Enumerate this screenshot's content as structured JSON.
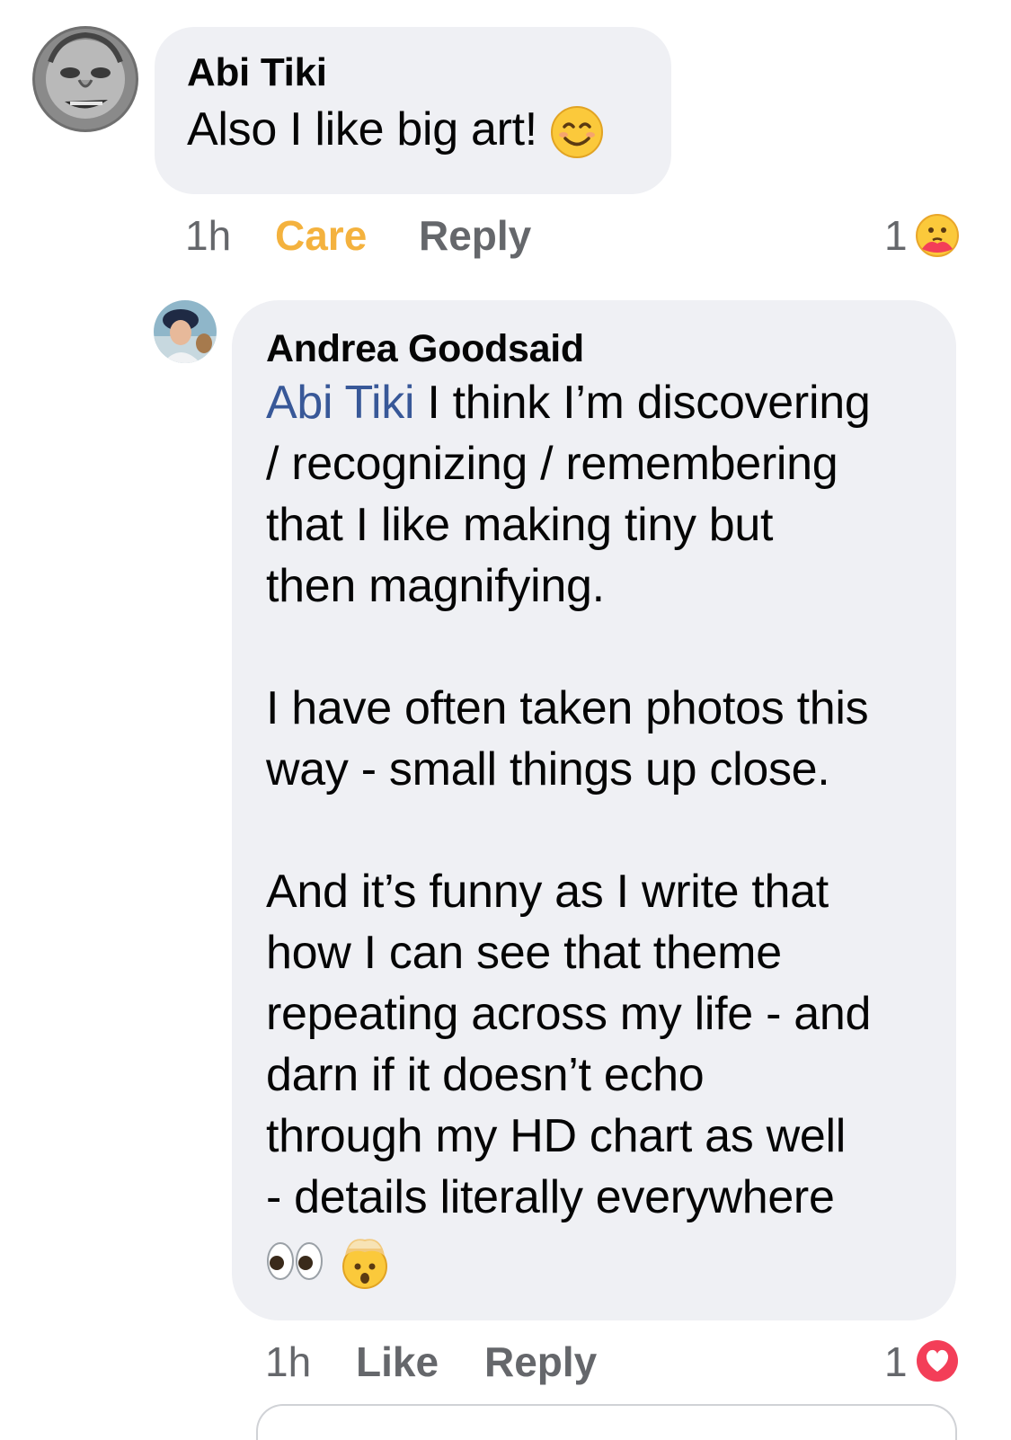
{
  "comments": [
    {
      "author": "Abi Tiki",
      "text": "Also I like big art!",
      "text_emoji": "smiling-face-emoji",
      "time": "1h",
      "reaction_action": "Care",
      "reply_label": "Reply",
      "reaction_count": "1",
      "reaction_icon": "care-reaction-icon",
      "reaction_color": "#f4b23e"
    },
    {
      "author": "Andrea Goodsaid",
      "mention": "Abi Tiki",
      "line1_rest": " I think I’m discovering",
      "line2": "/ recognizing / remembering",
      "line3": "that I like making tiny but",
      "line4": "then magnifying.",
      "para2_line1": "I have often taken photos this",
      "para2_line2": "way - small things up close.",
      "para3_line1": "And it’s funny as I write that",
      "para3_line2": "how I can see that theme",
      "para3_line3": "repeating across my life - and",
      "para3_line4": "darn if it doesn’t echo",
      "para3_line5": "through my HD chart as well",
      "para3_line6": "- details literally everywhere",
      "end_emojis": [
        "eyes-emoji",
        "exploding-head-emoji"
      ],
      "time": "1h",
      "reaction_action": "Like",
      "reply_label": "Reply",
      "reaction_count": "1",
      "reaction_icon": "love-reaction-icon",
      "reaction_color": "#f33e58"
    }
  ],
  "colors": {
    "bubble": "#eff0f4",
    "secondary_text": "#65676b",
    "mention": "#385898"
  }
}
